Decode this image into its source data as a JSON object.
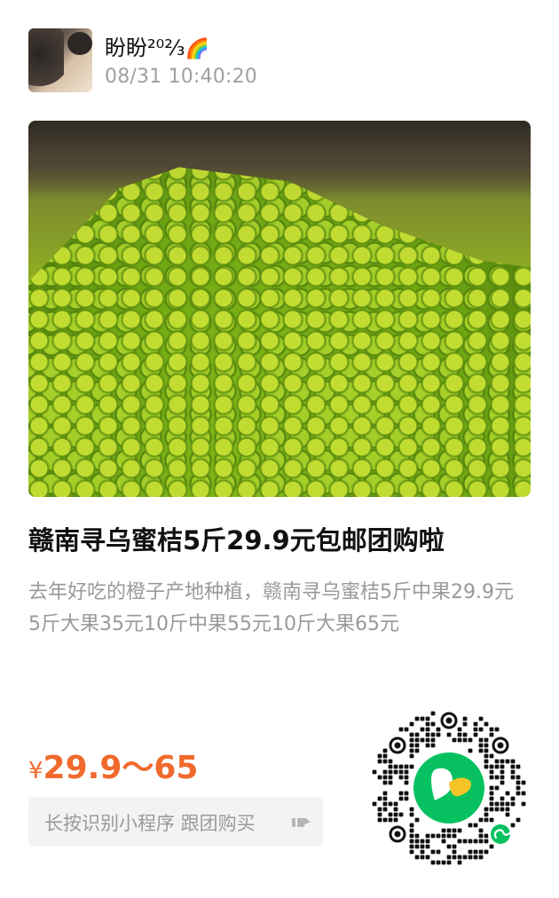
{
  "user": {
    "name": "盼盼²⁰²⁄₃",
    "badge": "🌈",
    "timestamp": "08/31 10:40:20"
  },
  "product": {
    "title": "赣南寻乌蜜桔5斤29.9元包邮团购啦",
    "description": "去年好吃的橙子产地种植，赣南寻乌蜜桔5斤中果29.9元5斤大果35元10斤中果55元10斤大果65元",
    "price_symbol": "¥",
    "price_range": "29.9～65"
  },
  "cta": {
    "label": "长按识别小程序 跟团购买"
  },
  "icons": {
    "arrow": "hand-pointer-icon",
    "qr": "qr-code-icon",
    "mini_program": "mini-program-icon"
  },
  "colors": {
    "price": "#f06a2c",
    "muted_text": "#999999",
    "qr_logo_bg": "#07c160",
    "cta_bg": "#f3f3f3"
  }
}
